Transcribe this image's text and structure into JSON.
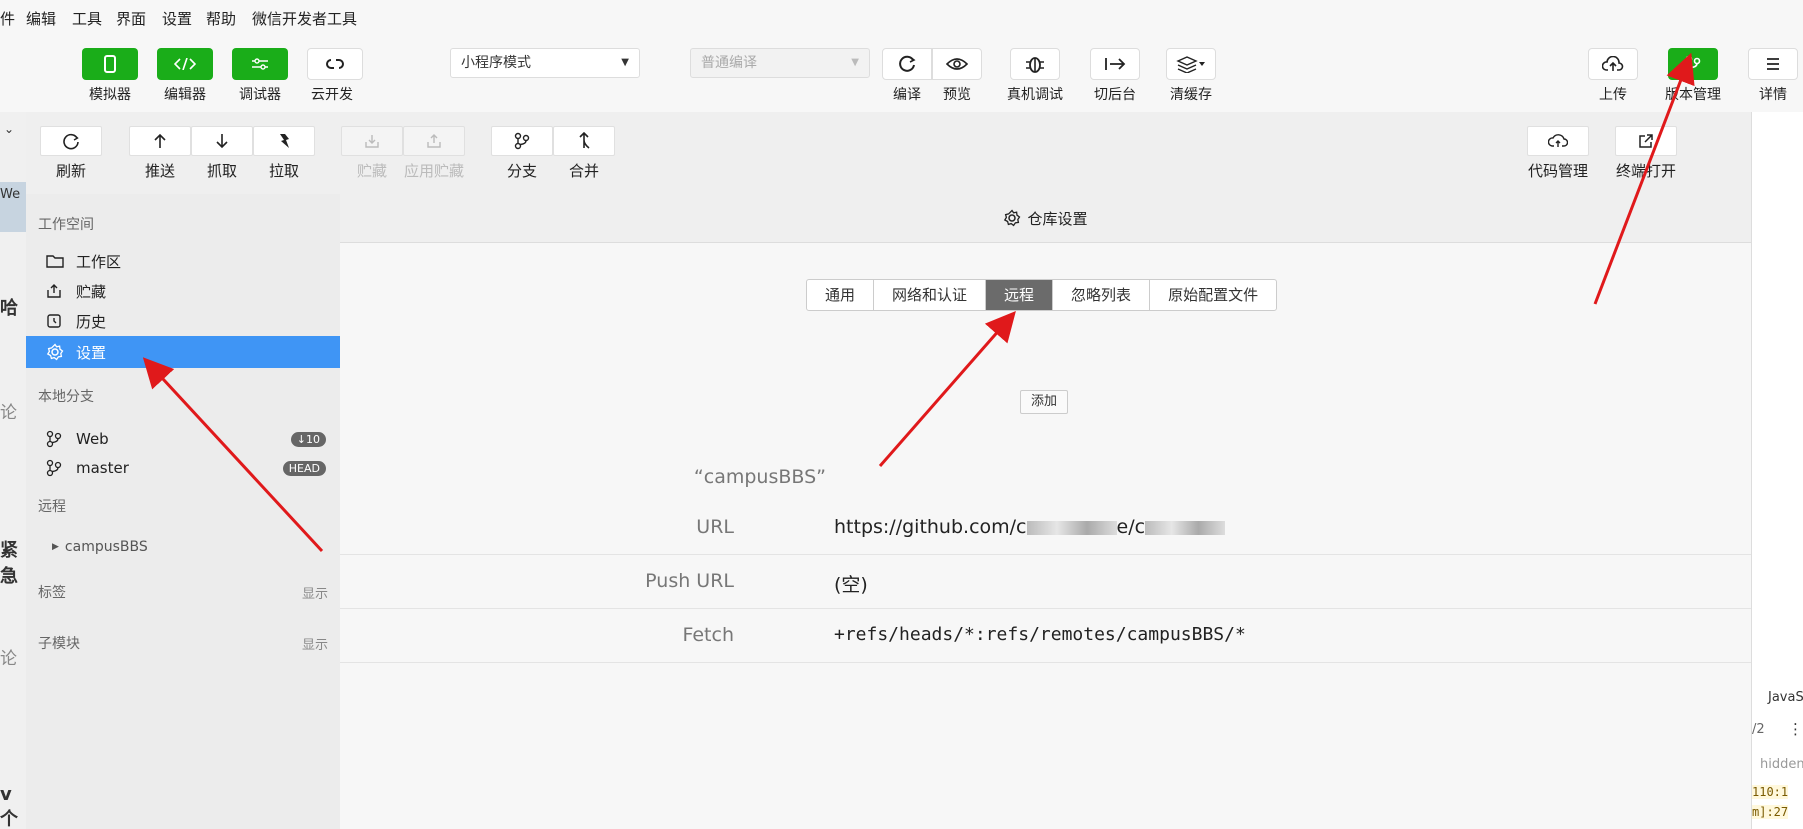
{
  "menu": [
    "件",
    "编辑",
    "工具",
    "界面",
    "设置",
    "帮助",
    "微信开发者工具"
  ],
  "toolbar": {
    "simulator": "模拟器",
    "editor": "编辑器",
    "debugger": "调试器",
    "cloud": "云开发",
    "mode_select": "小程序模式",
    "compile_select": "普通编译",
    "compile": "编译",
    "preview": "预览",
    "remote_debug": "真机调试",
    "background": "切后台",
    "clear_cache": "清缓存",
    "upload": "上传",
    "version_mgmt": "版本管理",
    "details": "详情"
  },
  "git_toolbar": {
    "refresh": "刷新",
    "push": "推送",
    "fetch": "抓取",
    "pull": "拉取",
    "stash": "贮藏",
    "apply_stash": "应用贮藏",
    "branch": "分支",
    "merge": "合并",
    "code_mgmt": "代码管理",
    "terminal_open": "终端打开"
  },
  "sidebar": {
    "workspace_title": "工作空间",
    "items": [
      {
        "label": "工作区"
      },
      {
        "label": "贮藏"
      },
      {
        "label": "历史"
      },
      {
        "label": "设置"
      }
    ],
    "local_branch_title": "本地分支",
    "branches": [
      {
        "label": "Web",
        "badge": "↓10"
      },
      {
        "label": "master",
        "badge": "HEAD"
      }
    ],
    "remote_title": "远程",
    "remote_item": "campusBBS",
    "tags_title": "标签",
    "tags_show": "显示",
    "submodule_title": "子模块",
    "submodule_show": "显示"
  },
  "content": {
    "title": "仓库设置",
    "tabs": [
      "通用",
      "网络和认证",
      "远程",
      "忽略列表",
      "原始配置文件"
    ],
    "active_tab": "远程",
    "add_button": "添加",
    "remote_name": "“campusBBS”",
    "url_label": "URL",
    "url_value": "https://github.com/c",
    "url_mid": "e/c",
    "push_label": "Push URL",
    "push_value": "(空)",
    "fetch_label": "Fetch",
    "fetch_value": "+refs/heads/*:refs/remotes/campusBBS/*"
  },
  "right_panel": {
    "lang": "JavaS",
    "page": "/2",
    "hidden": "hidden",
    "line1": "110:1",
    "line2": "m]:27"
  },
  "left_strip": {
    "t1": "We",
    "t2": "哈",
    "t3": "论",
    "t4": "紧急",
    "t5": "论",
    "t6": "v个"
  },
  "colors": {
    "accent_green": "#1aad19",
    "selection_blue": "#3f95f5",
    "arrow_red": "#e0191b"
  }
}
